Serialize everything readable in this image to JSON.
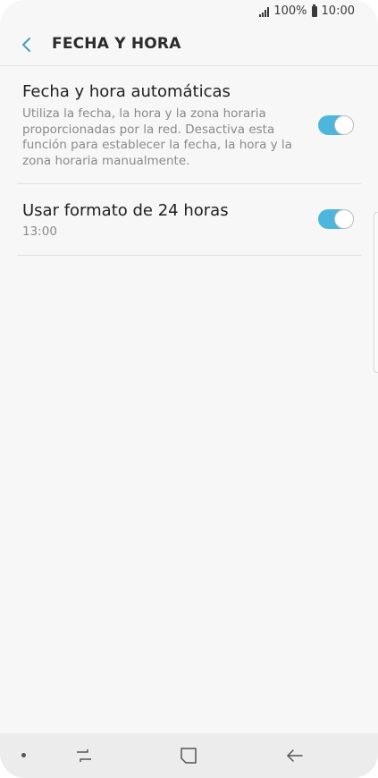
{
  "status_bar": {
    "battery_text": "100%",
    "time": "10:00"
  },
  "header": {
    "title": "FECHA Y HORA",
    "back_icon": "back-arrow-icon"
  },
  "settings": [
    {
      "title": "Fecha y hora automáticas",
      "subtitle_lines": [
        "Utiliza la fecha, la hora y la zona horaria",
        "proporcionadas por la red. Desactiva esta",
        "función para establecer la fecha, la hora y la",
        "zona horaria manualmente."
      ],
      "enabled": true
    },
    {
      "title": "Usar formato de 24 horas",
      "subtitle": "13:00",
      "enabled": true
    }
  ],
  "nav_bar": {
    "icons": [
      "dot-icon",
      "recent-apps-icon",
      "home-icon",
      "back-icon"
    ]
  },
  "colors": {
    "accent": "#4eb6dd",
    "background": "#f7f7f7",
    "nav_bar": "#ececec"
  }
}
